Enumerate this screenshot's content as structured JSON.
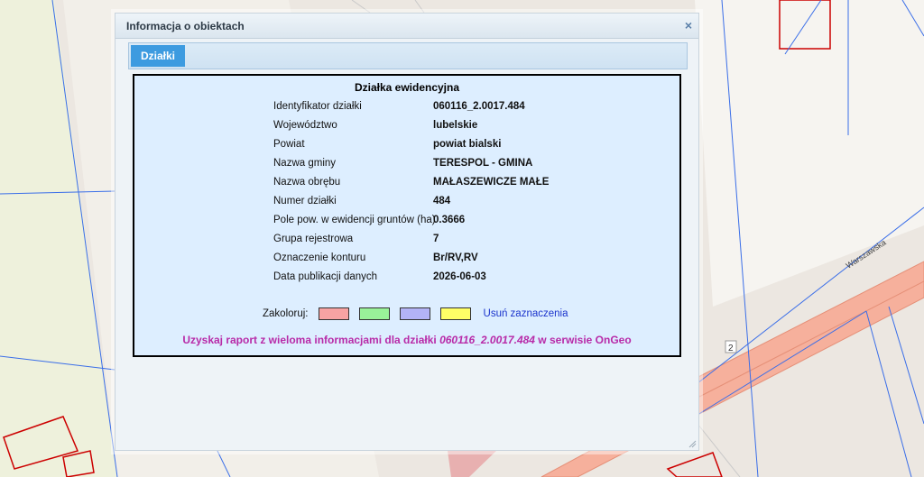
{
  "map": {
    "street_name": "Warszawska",
    "house_number": "2"
  },
  "dialog": {
    "title": "Informacja o obiektach",
    "close_symbol": "×",
    "tab_label": "Działki",
    "heading": "Działka ewidencyjna",
    "rows": [
      {
        "label": "Identyfikator działki",
        "value": "060116_2.0017.484"
      },
      {
        "label": "Województwo",
        "value": "lubelskie"
      },
      {
        "label": "Powiat",
        "value": "powiat bialski"
      },
      {
        "label": "Nazwa gminy",
        "value": "TERESPOL - GMINA"
      },
      {
        "label": "Nazwa obrębu",
        "value": "MAŁASZEWICZE MAŁE"
      },
      {
        "label": "Numer działki",
        "value": "484"
      },
      {
        "label": "Pole pow. w ewidencji gruntów (ha)",
        "value": "0.3666"
      },
      {
        "label": "Grupa rejestrowa",
        "value": "7"
      },
      {
        "label": "Oznaczenie konturu",
        "value": "Br/RV,RV"
      },
      {
        "label": "Data publikacji danych",
        "value": "2026-06-03"
      }
    ],
    "colorize": {
      "label": "Zakoloruj:",
      "swatches": [
        "#f7a3a3",
        "#99f299",
        "#b3b3f7",
        "#ffff66"
      ],
      "clear_label": "Usuń zaznaczenia"
    },
    "report": {
      "prefix": "Uzyskaj raport z wieloma informacjami dla działki ",
      "parcel_id": "060116_2.0017.484",
      "suffix": " w serwisie OnGeo"
    }
  }
}
